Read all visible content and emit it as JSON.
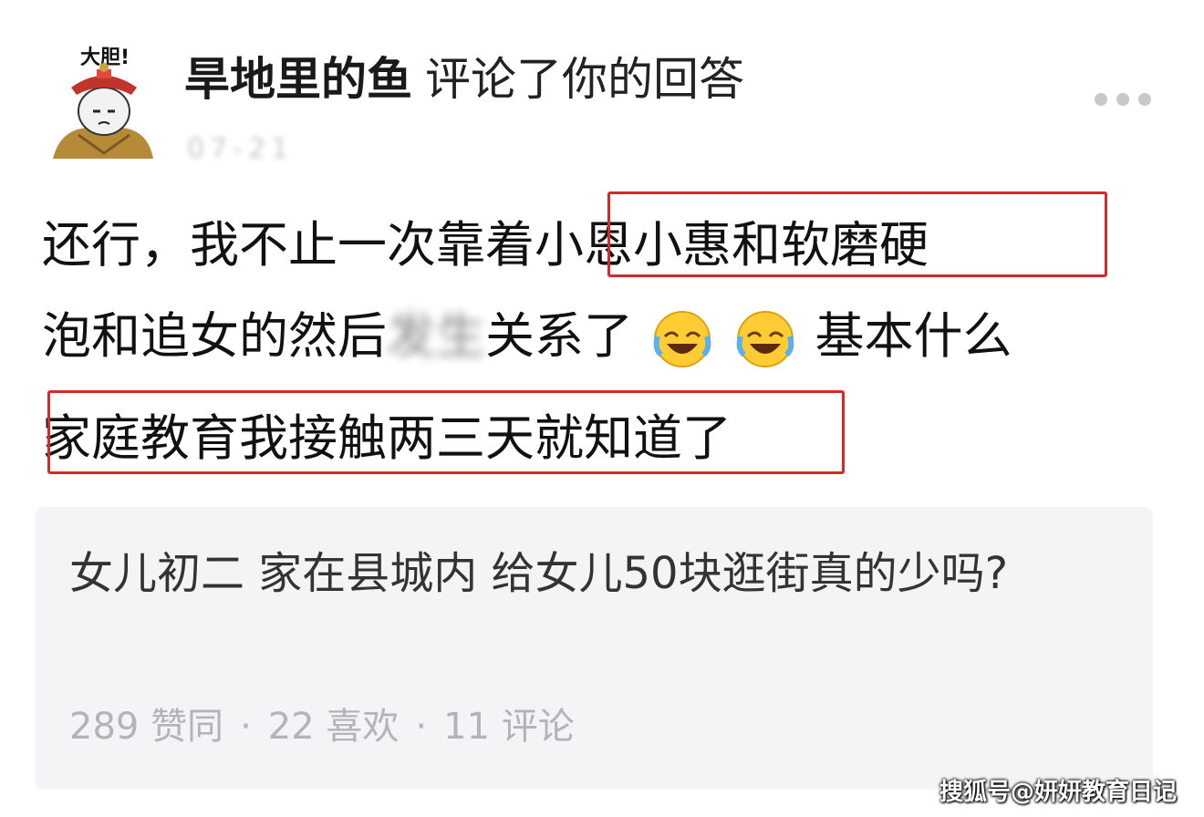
{
  "author": {
    "avatar_caption": "大胆!",
    "username": "旱地里的鱼",
    "action": "评论了你的回答",
    "timestamp": "07-21"
  },
  "comment": {
    "line1_a": "还行，我不止一次靠着",
    "line1_b": "小恩小惠和软磨硬",
    "line2_a": "泡和追女的然后",
    "line2_blur": "发生",
    "line2_b": "关系了",
    "line2_c": "基本什么",
    "line3": "家庭教育我接触两三天就知道了",
    "emojis": [
      "laugh-cry-emoji",
      "laugh-cry-emoji"
    ]
  },
  "quoted_answer": {
    "title": "女儿初二 家在县城内 给女儿50块逛街真的少吗?",
    "likes": "289 赞同",
    "favorites": "22 喜欢",
    "comments": "11 评论",
    "separator": "·"
  },
  "watermark": "搜狐号@妍妍教育日记",
  "colors": {
    "highlight": "#d42a2a",
    "card_bg": "#f4f4f6",
    "muted": "#b4b4b8"
  }
}
